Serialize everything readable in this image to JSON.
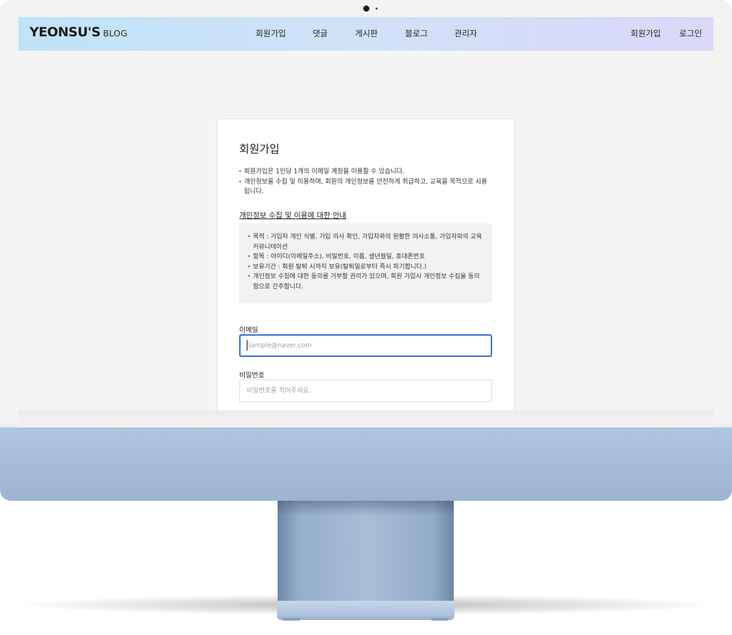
{
  "header": {
    "logo_strong": "YEONSU'S",
    "logo_light": "BLOG",
    "nav": [
      "회원가입",
      "댓글",
      "게시판",
      "블로그",
      "관리자"
    ],
    "util": [
      "회원가입",
      "로그인"
    ]
  },
  "signup": {
    "title": "회원가입",
    "notices": [
      "회원가입은 1인당 1개의 이메일 계정을 이용할 수 있습니다.",
      "개인정보를 수집 및 이용하며, 회원의 개인정보를 안전하게 취급하고, 교육을 목적으로 사용됩니다."
    ],
    "privacy_heading": "개인정보 수집 및 이용에 대한 안내",
    "privacy_items": [
      "목적 : 가입자 개인 식별, 가입 의사 확인, 가입자와의 원활한 의사소통, 가입자와의 교육 커뮤니테이션",
      "항목 : 아이디(이메일주소), 비밀번호, 이름, 생년월일, 휴대폰번호",
      "보유기간 : 회원 탈퇴 시까지 보유(탈퇴일로부터 즉시 파기합니다.)",
      "개인정보 수집에 대한 동의를 거부할 권리가 있으며, 회원 가입시 개인정보 수집을 동의함으로 간주합니다."
    ],
    "email_label": "이메일",
    "email_placeholder": "Sample@naver.com",
    "email_value": "",
    "password_label": "비밀번호",
    "password_placeholder": "비밀번호를 적어주세요.",
    "password_value": ""
  },
  "colors": {
    "header_gradient_start": "#bfe3f7",
    "header_gradient_end": "#dad8f9",
    "focus_border": "#2f6fcf",
    "info_box_bg": "#f2f2f2",
    "page_bg": "#f4f4f4",
    "device_chin": "#a7bed8"
  }
}
